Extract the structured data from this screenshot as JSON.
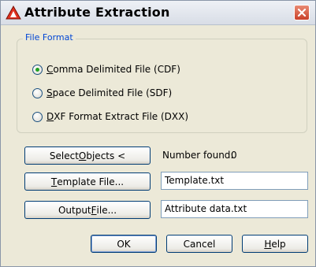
{
  "window": {
    "title": "Attribute Extraction"
  },
  "file_format": {
    "group_label": "File Format",
    "options": [
      {
        "mnemonic": "C",
        "rest": "omma Delimited File (CDF)",
        "selected": true
      },
      {
        "mnemonic": "S",
        "rest": "pace Delimited File (SDF)",
        "selected": false
      },
      {
        "mnemonic": "D",
        "rest": "XF Format Extract File (DXX)",
        "selected": false
      }
    ]
  },
  "select_objects": {
    "pre": "Select ",
    "mnemonic": "O",
    "post": "bjects <"
  },
  "number_found": {
    "label": "Number found:",
    "value": "0"
  },
  "template": {
    "button_mnemonic": "T",
    "button_rest": "emplate File...",
    "value": "Template.txt"
  },
  "output": {
    "button_pre": "Output ",
    "button_mnemonic": "F",
    "button_post": "ile...",
    "value": "Attribute data.txt"
  },
  "footer": {
    "ok": "OK",
    "cancel": "Cancel",
    "help_mnemonic": "H",
    "help_rest": "elp"
  },
  "colors": {
    "group_label": "#0046d5",
    "close_button": "#c9412a",
    "app_icon": "#e0301e",
    "radio_dot": "#21a121"
  }
}
